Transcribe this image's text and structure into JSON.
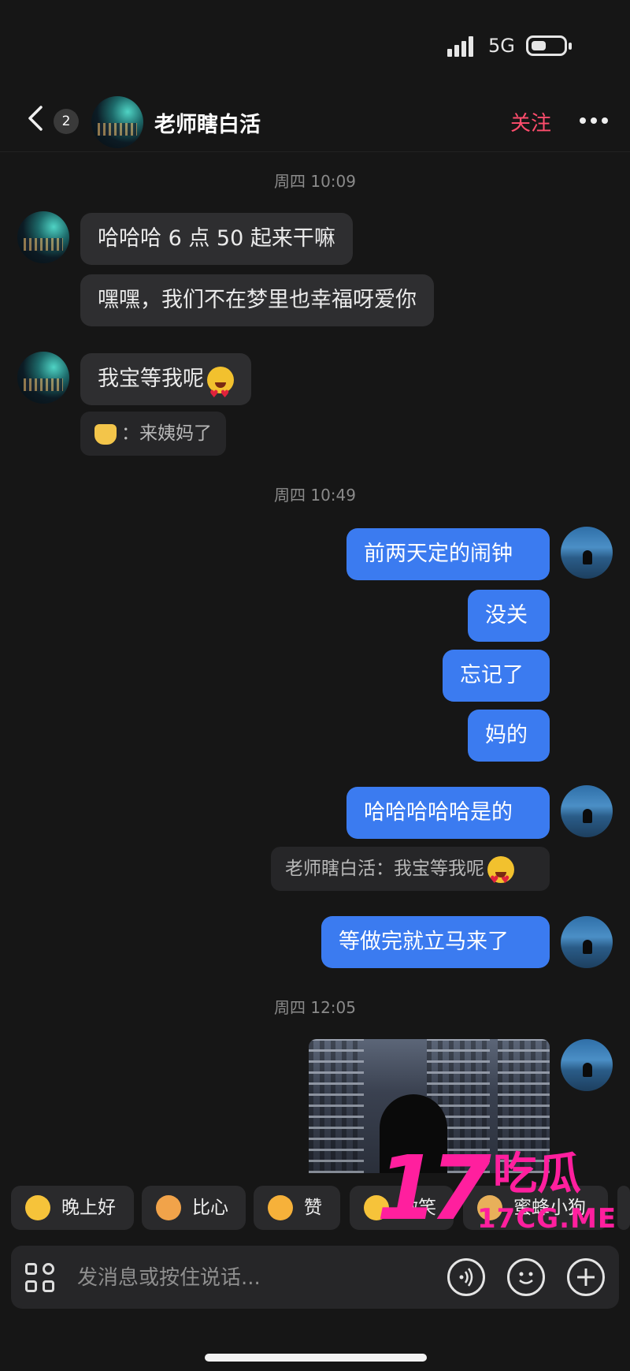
{
  "status_bar": {
    "network": "5G"
  },
  "header": {
    "unread_count": "2",
    "contact_name": "老师瞎白活",
    "follow_label": "关注"
  },
  "timestamps": [
    "周四 10:09",
    "周四 10:49",
    "周四 12:05"
  ],
  "messages": {
    "m1": "哈哈哈 6 点 50 起来干嘛",
    "m2": "嘿嘿，我们不在梦里也幸福呀爱你",
    "m3": "我宝等我呢",
    "m3_quote": "：来姨妈了",
    "m4": "前两天定的闹钟",
    "m5": "没关",
    "m6": "忘记了",
    "m7": "妈的",
    "m8": "哈哈哈哈哈是的",
    "m8_quote": "老师瞎白活：我宝等我呢",
    "m9": "等做完就立马来了"
  },
  "quick_replies": [
    {
      "label": "晚上好",
      "icon": "star-face-icon",
      "color": "#f6c33a"
    },
    {
      "label": "比心",
      "icon": "heart-hand-icon",
      "color": "#f1a34a"
    },
    {
      "label": "赞",
      "icon": "thumbs-up-icon",
      "color": "#f6b13a"
    },
    {
      "label": "微笑",
      "icon": "smile-icon",
      "color": "#f6c33a"
    },
    {
      "label": "蜜蜂小狗",
      "icon": "bee-dog-icon",
      "color": "#e8b05a"
    }
  ],
  "composer": {
    "placeholder": "发消息或按住说话..."
  },
  "watermark": {
    "number": "17",
    "chars": "吃瓜",
    "url": "17CG.ME"
  },
  "colors": {
    "accent_blue": "#3b7bf0",
    "follow_red": "#ff4d6d",
    "watermark_pink": "#ff1f9e"
  }
}
